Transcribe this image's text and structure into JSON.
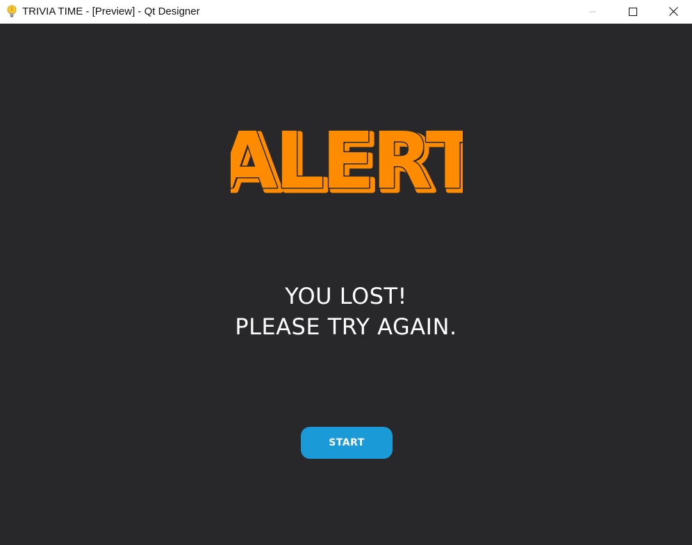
{
  "window": {
    "title": "TRIVIA TIME - [Preview] - Qt Designer",
    "icon": "lightbulb-icon",
    "controls": {
      "minimize_icon": "minimize-icon",
      "maximize_icon": "maximize-icon",
      "close_icon": "close-icon"
    }
  },
  "screen": {
    "heading": "ALERT",
    "message_line1": "YOU LOST!",
    "message_line2": "PLEASE TRY AGAIN.",
    "start_label": "START"
  },
  "colors": {
    "background": "#28282b",
    "alert_fill": "#ff8c00",
    "alert_outline": "#2a2a2a",
    "button": "#1a9ad6",
    "text": "#ffffff"
  }
}
